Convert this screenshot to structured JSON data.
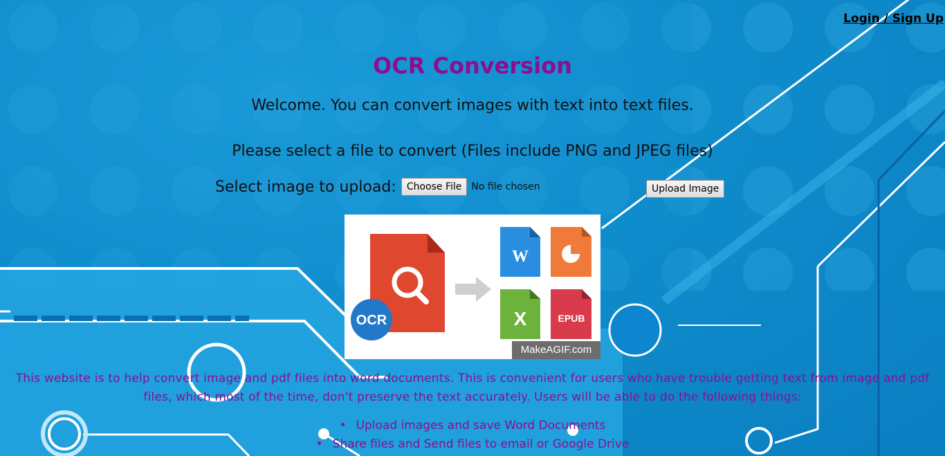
{
  "header": {
    "login_link": "Login / Sign Up"
  },
  "main": {
    "title": "OCR Conversion",
    "welcome": "Welcome. You can convert images with text into text files.",
    "select_prompt": "Please select a file to convert (Files include PNG and JPEG files)",
    "upload": {
      "label": "Select image to upload:",
      "choose_file_label": "Choose File",
      "no_file_text": "No file chosen",
      "upload_button_label": "Upload Image"
    },
    "gif": {
      "ocr_badge": "OCR",
      "word_letter": "W",
      "excel_letter": "X",
      "epub_label": "EPUB",
      "watermark": "MakeAGIF.com"
    },
    "description": "This website is to help convert image and pdf files into word documents. This is convenient for users who have trouble getting text from image and pdf files, which most of the time, don't preserve the text accurately. Users will be able to do the following things:",
    "features": [
      "Upload images and save Word Documents",
      "Share files and Send files to email or Google Drive"
    ]
  },
  "colors": {
    "title": "#8b0f8f",
    "background": "#0f8ccc",
    "circuit": "#ffffff"
  }
}
